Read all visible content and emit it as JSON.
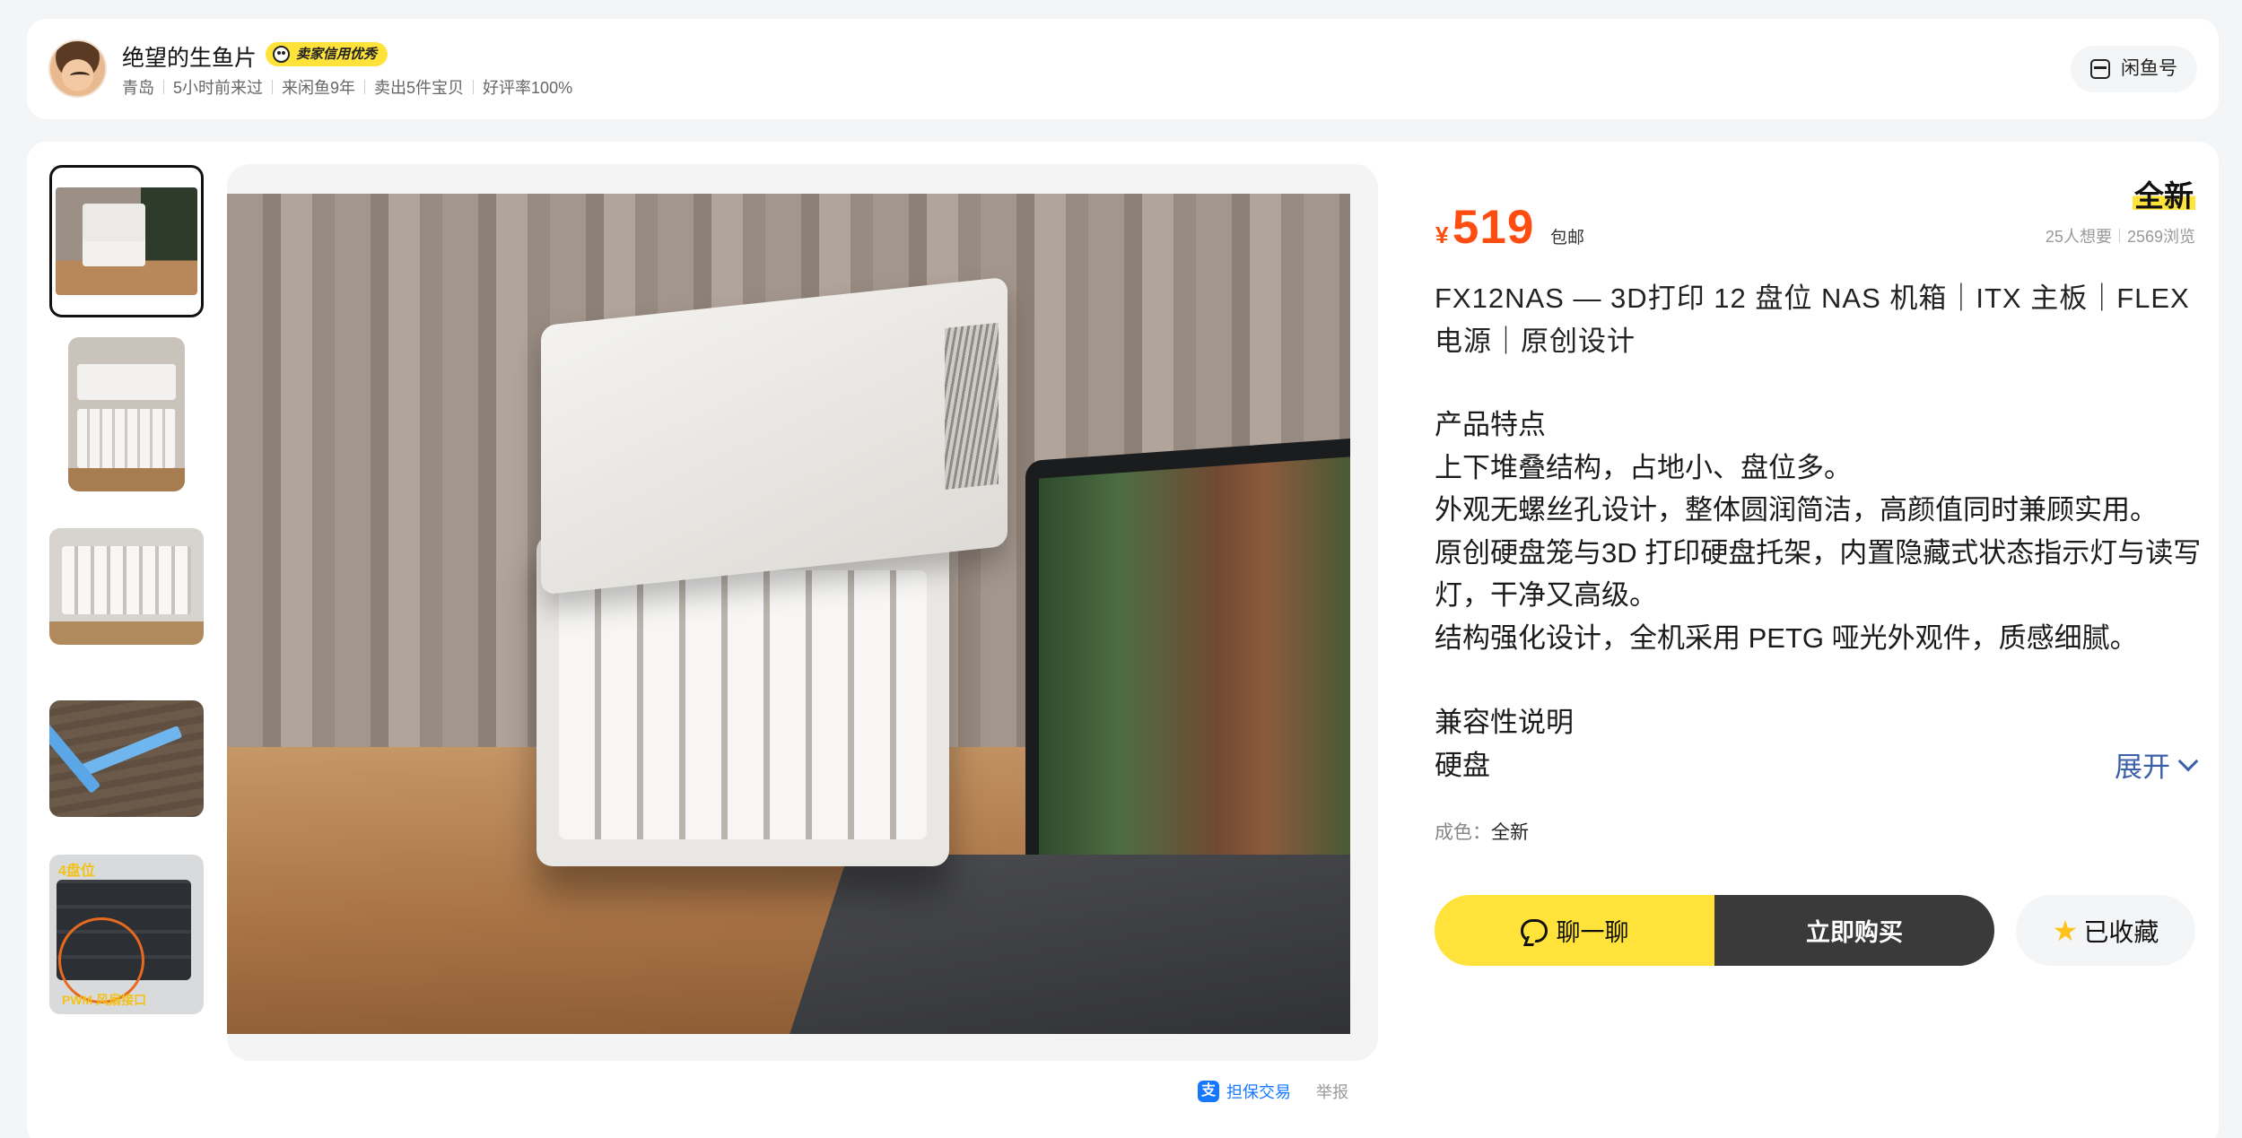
{
  "seller": {
    "name": "绝望的生鱼片",
    "credit_badge": "卖家信用优秀",
    "meta": [
      "青岛",
      "5小时前来过",
      "来闲鱼9年",
      "卖出5件宝贝",
      "好评率100%"
    ],
    "xianyu_label": "闲鱼号"
  },
  "gallery": {
    "thumb5_top": "4盘位",
    "thumb5_bottom": "PWM 风扇接口"
  },
  "trade": {
    "guarantee_label": "担保交易",
    "report_label": "举报"
  },
  "item": {
    "condition": "全新",
    "currency": "¥",
    "price": "519",
    "shipping": "包邮",
    "wants": "25人想要",
    "views": "2569浏览",
    "title": "FX12NAS — 3D打印 12 盘位 NAS 机箱｜ITX 主板｜FLEX 电源｜原创设计",
    "description": {
      "features_heading": "产品特点",
      "features": [
        "上下堆叠结构，占地小、盘位多。",
        "外观无螺丝孔设计，整体圆润简洁，高颜值同时兼顾实用。",
        "原创硬盘笼与3D 打印硬盘托架，内置隐藏式状态指示灯与读写灯，干净又高级。",
        "结构强化设计，全机采用 PETG 哑光外观件，质感细腻。"
      ],
      "compat_heading": "兼容性说明",
      "compat_first": "硬盘"
    },
    "expand_label": "展开",
    "attr_key": "成色：",
    "attr_value": "全新"
  },
  "actions": {
    "chat_label": "聊一聊",
    "buy_label": "立即购买",
    "fav_label": "已收藏"
  },
  "colors": {
    "accent_yellow": "#ffe33a",
    "price_orange": "#ff4d11",
    "link_blue": "#3b5fa8",
    "alipay_blue": "#1677ff"
  }
}
